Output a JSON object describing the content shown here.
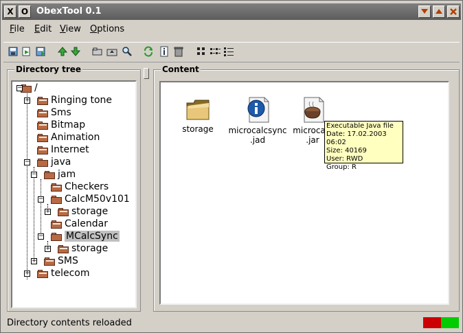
{
  "window": {
    "title": "ObexTool 0.1",
    "sys_icon_left": "X",
    "sys_icon_right": "O",
    "buttons": [
      "minimize-icon",
      "maximize-icon",
      "close-icon"
    ]
  },
  "menu": [
    "File",
    "Edit",
    "View",
    "Options"
  ],
  "toolbar": {
    "icons": [
      "save-icon",
      "import-icon",
      "export-icon",
      "up-arrow-icon",
      "down-arrow-icon",
      "open-folder-icon",
      "parent-folder-icon",
      "search-icon",
      "refresh-icon",
      "info-icon",
      "trash-icon",
      "large-icons-view-icon",
      "small-icons-view-icon",
      "list-view-icon"
    ]
  },
  "tree": {
    "title": "Directory tree",
    "items": [
      {
        "label": "/",
        "indent": 0,
        "expander": "minus"
      },
      {
        "label": "Ringing tone",
        "indent": 1,
        "expander": "plus"
      },
      {
        "label": "Sms",
        "indent": 1
      },
      {
        "label": "Bitmap",
        "indent": 1
      },
      {
        "label": "Animation",
        "indent": 1
      },
      {
        "label": "Internet",
        "indent": 1
      },
      {
        "label": "java",
        "indent": 1,
        "expander": "minus"
      },
      {
        "label": "jam",
        "indent": 2,
        "expander": "minus"
      },
      {
        "label": "Checkers",
        "indent": 3
      },
      {
        "label": "CalcM50v101",
        "indent": 3,
        "expander": "minus"
      },
      {
        "label": "storage",
        "indent": 4,
        "expander": "plus"
      },
      {
        "label": "Calendar",
        "indent": 3
      },
      {
        "label": "MCalcSync",
        "indent": 3,
        "expander": "minus",
        "selected": true
      },
      {
        "label": "storage",
        "indent": 4,
        "expander": "plus"
      },
      {
        "label": "SMS",
        "indent": 2,
        "expander": "plus"
      },
      {
        "label": "telecom",
        "indent": 1,
        "expander": "plus"
      }
    ]
  },
  "content": {
    "title": "Content",
    "files": [
      {
        "name": "storage",
        "icon": "folder-icon"
      },
      {
        "name": "microcalcsync\n.jad",
        "icon": "info-file-icon"
      },
      {
        "name": "microcalc\n.jar",
        "icon": "java-file-icon"
      }
    ],
    "tooltip": [
      "Executable Java file",
      "Date: 17.02.2003 06:02",
      "Size: 40169",
      "User: RWD",
      "Group: R"
    ]
  },
  "status": {
    "text": "Directory contents reloaded",
    "colors": {
      "left": "#cc0000",
      "right": "#00cc00"
    }
  }
}
